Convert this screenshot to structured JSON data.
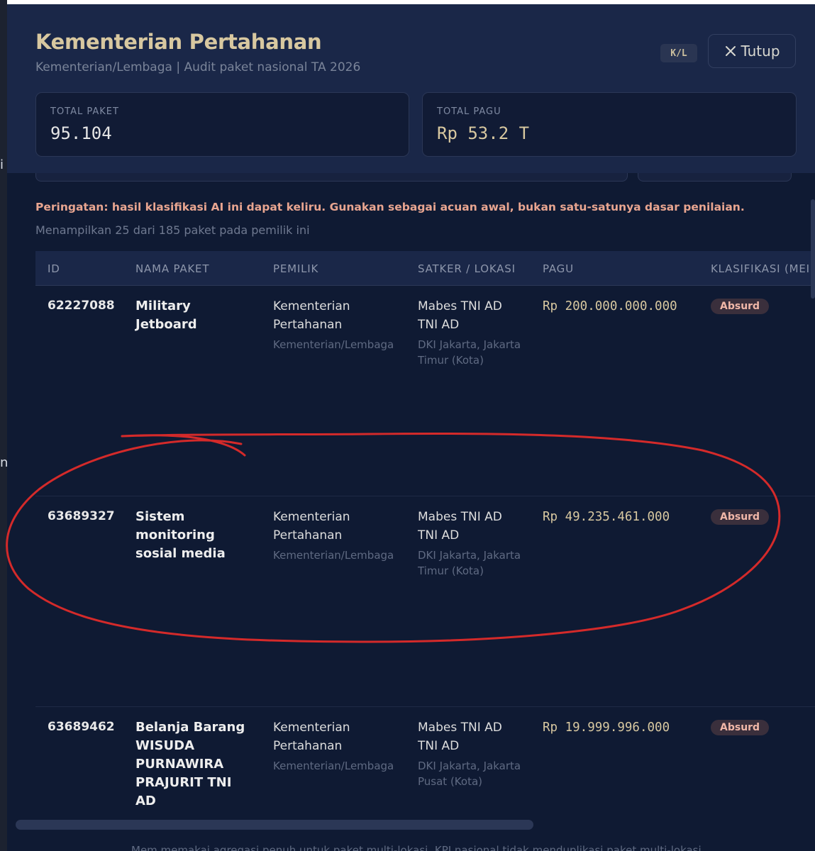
{
  "backdrop": {
    "edge_chars": [
      "i",
      "n"
    ]
  },
  "header": {
    "title": "Kementerian Pertahanan",
    "subtitle": "Kementerian/Lembaga | Audit paket nasional TA 2026",
    "badge": "K/L",
    "close_label": "Tutup"
  },
  "stats": {
    "total_paket_label": "TOTAL PAKET",
    "total_paket_value": "95.104",
    "total_pagu_label": "TOTAL PAGU",
    "total_pagu_value": "Rp 53.2 T"
  },
  "warning": "Peringatan: hasil klasifikasi AI ini dapat keliru. Gunakan sebagai acuan awal, bukan satu-satunya dasar penilaian.",
  "showing": "Menampilkan 25 dari 185 paket pada pemilik ini",
  "table": {
    "columns": [
      "ID",
      "NAMA PAKET",
      "PEMILIK",
      "SATKER / LOKASI",
      "PAGU",
      "KLASIFIKASI (MEI"
    ],
    "rows": [
      {
        "id": "62227088",
        "name": "Military Jetboard",
        "owner": "Kementerian Pertahanan",
        "owner_type": "Kementerian/Lembaga",
        "satker": "Mabes TNI AD TNI AD",
        "location": "DKI Jakarta, Jakarta Timur (Kota)",
        "pagu": "Rp 200.000.000.000",
        "classification": "Absurd"
      },
      {
        "id": "63689327",
        "name": "Sistem monitoring sosial media",
        "owner": "Kementerian Pertahanan",
        "owner_type": "Kementerian/Lembaga",
        "satker": "Mabes TNI AD TNI AD",
        "location": "DKI Jakarta, Jakarta Timur (Kota)",
        "pagu": "Rp 49.235.461.000",
        "classification": "Absurd"
      },
      {
        "id": "63689462",
        "name": "Belanja Barang WISUDA PURNAWIRA PRAJURIT TNI AD",
        "owner": "Kementerian Pertahanan",
        "owner_type": "Kementerian/Lembaga",
        "satker": "Mabes TNI AD TNI AD",
        "location": "DKI Jakarta, Jakarta Pusat (Kota)",
        "pagu": "Rp 19.999.996.000",
        "classification": "Absurd"
      }
    ]
  },
  "footer_note": "Mem memakai agregasi penuh untuk paket multi-lokasi. KPI nasional tidak menduplikasi paket multi-lokasi.",
  "colors": {
    "modal_bg": "#0f1a33",
    "header_bg": "#1a2748",
    "title": "#d8c8a0",
    "warning": "#e8a590",
    "pill_bg": "#3a2f3c",
    "pill_text": "#f0b7a8",
    "annotation_red": "#d42a2a"
  }
}
